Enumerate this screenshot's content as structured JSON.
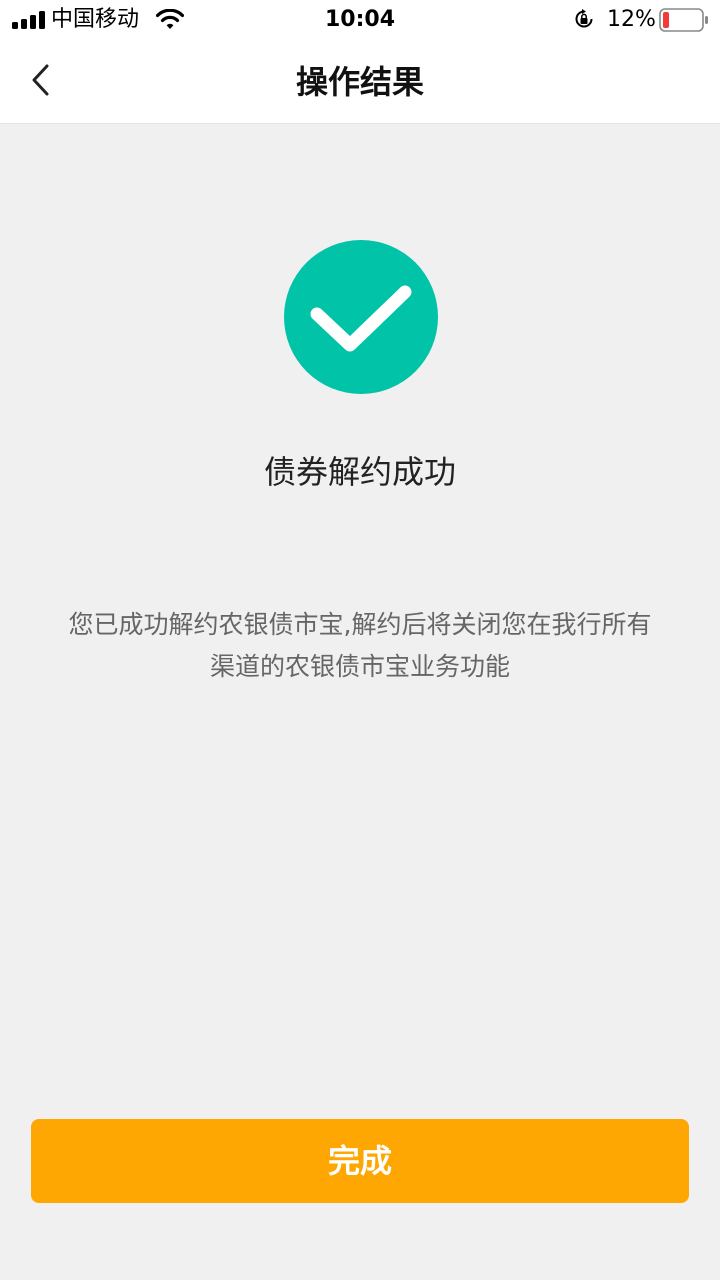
{
  "status_bar": {
    "carrier": "中国移动",
    "time": "10:04",
    "battery_percent": "12%",
    "battery_level": 0.12,
    "icons": [
      "signal-icon",
      "wifi-icon",
      "rotation-lock-icon",
      "battery-icon"
    ]
  },
  "nav": {
    "back_icon": "chevron-left-icon",
    "title": "操作结果"
  },
  "result": {
    "icon": "check-circle-icon",
    "title": "债券解约成功",
    "description": "您已成功解约农银债市宝,解约后将关闭您在我行所有渠道的农银债市宝业务功能"
  },
  "actions": {
    "done_label": "完成"
  },
  "colors": {
    "success": "#00c3a7",
    "accent": "#fea703",
    "background": "#f0f0f0",
    "battery_low": "#f23b3b"
  }
}
